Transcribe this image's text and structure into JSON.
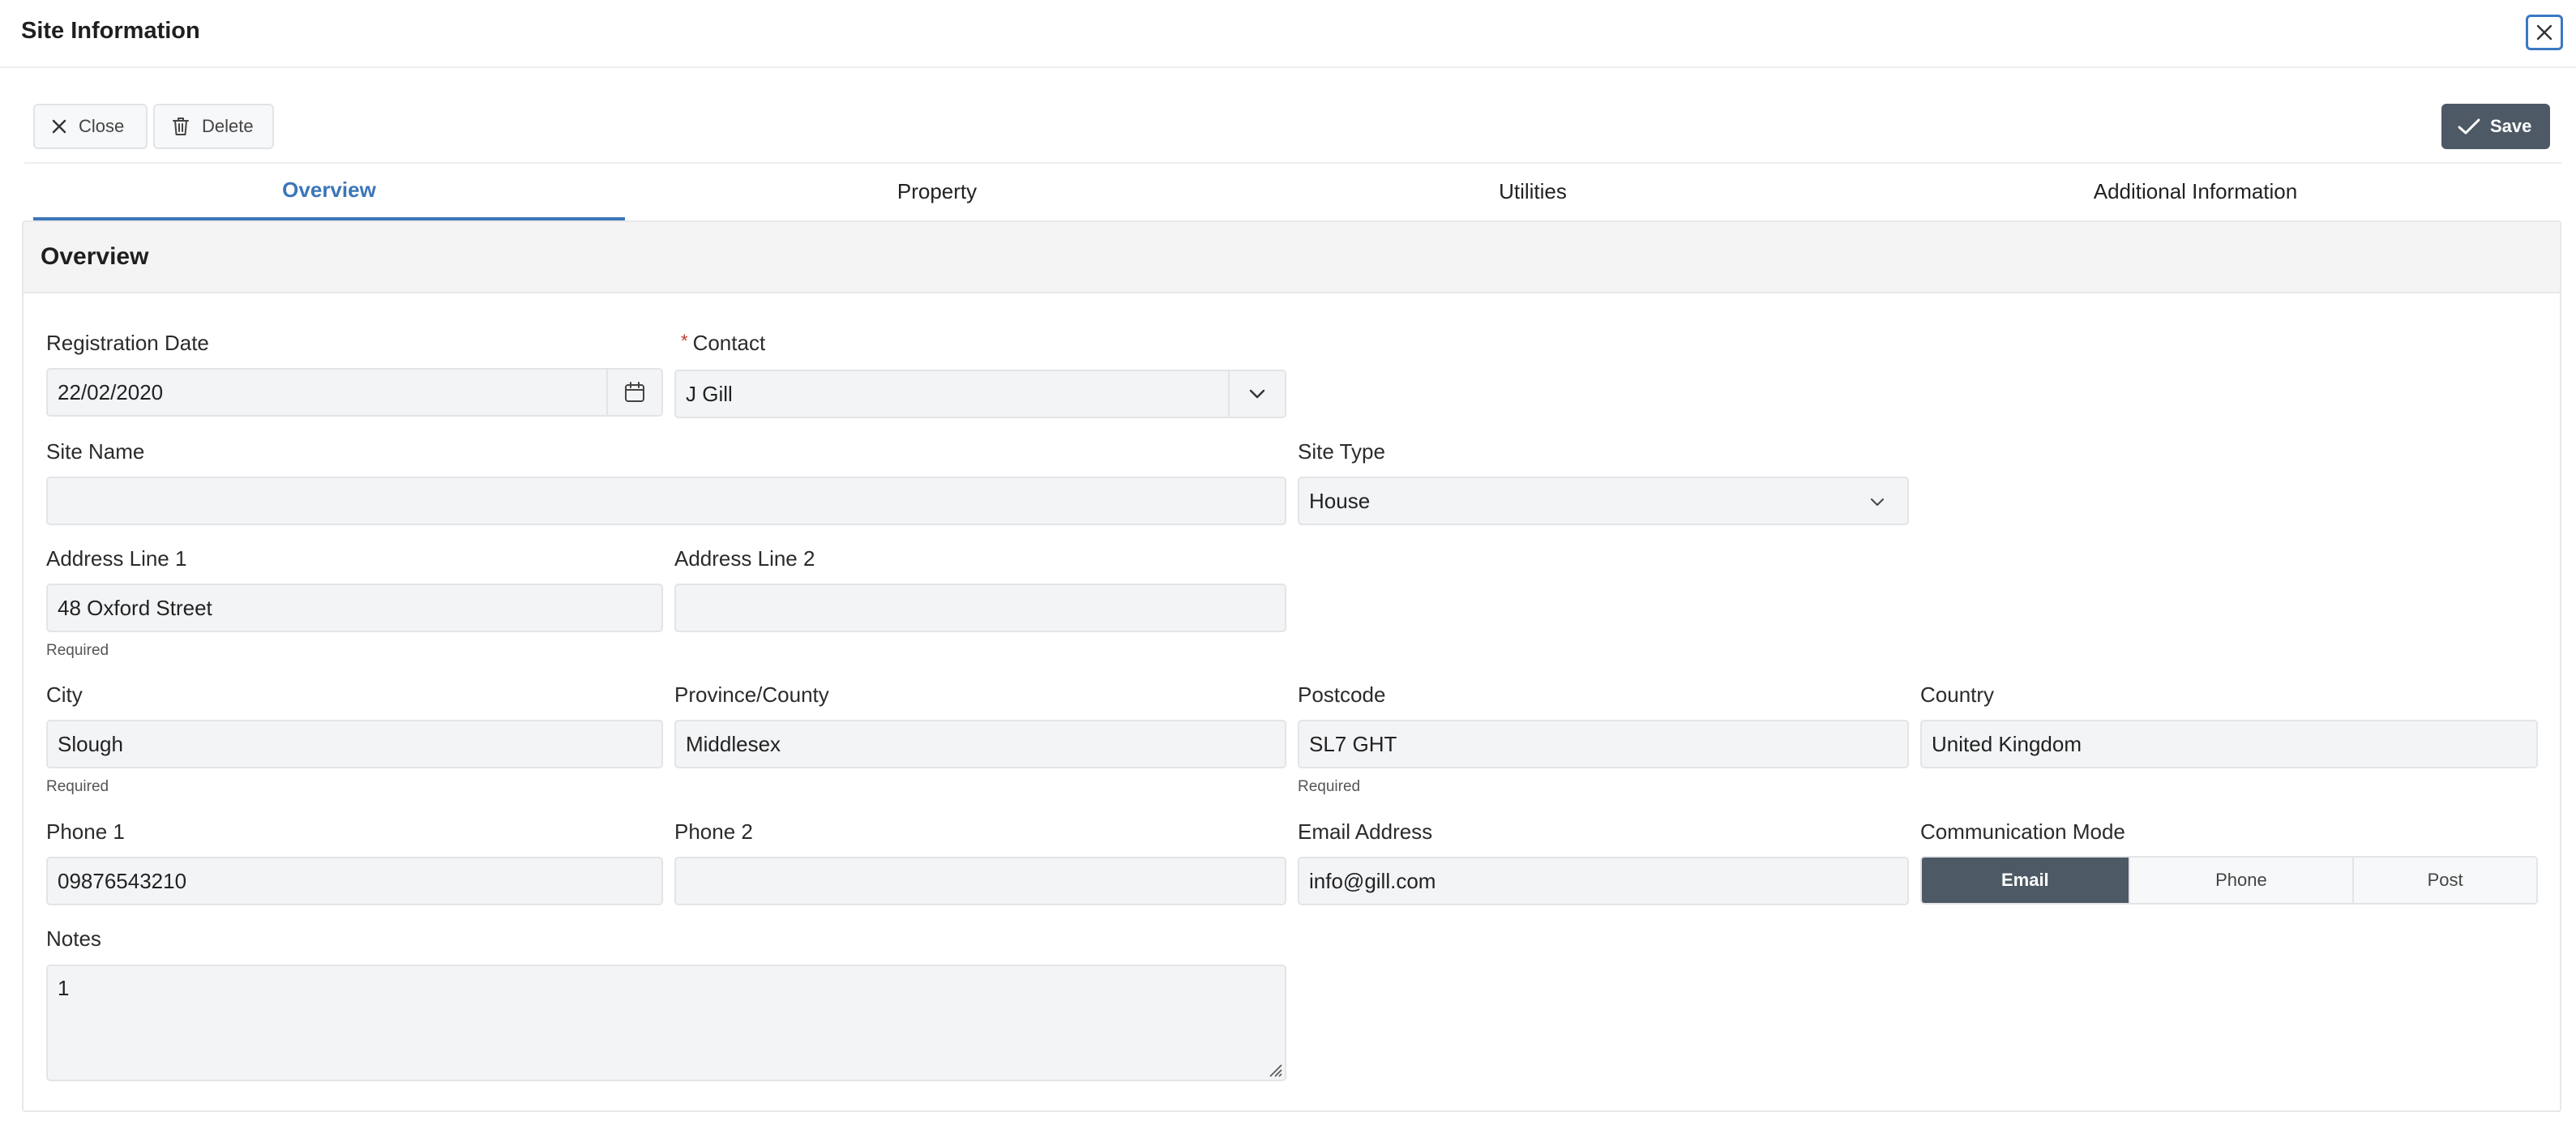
{
  "window": {
    "title": "Site Information"
  },
  "toolbar": {
    "close_label": "Close",
    "delete_label": "Delete",
    "save_label": "Save"
  },
  "tabs": [
    {
      "label": "Overview",
      "active": true
    },
    {
      "label": "Property",
      "active": false
    },
    {
      "label": "Utilities",
      "active": false
    },
    {
      "label": "Additional Information",
      "active": false
    }
  ],
  "section": {
    "title": "Overview"
  },
  "form": {
    "registration_date": {
      "label": "Registration Date",
      "value": "22/02/2020"
    },
    "contact": {
      "label": "Contact",
      "required_mark": "*",
      "value": "J Gill"
    },
    "site_name": {
      "label": "Site Name",
      "value": ""
    },
    "site_type": {
      "label": "Site Type",
      "value": "House"
    },
    "address_line_1": {
      "label": "Address Line 1",
      "value": "48 Oxford Street",
      "hint": "Required"
    },
    "address_line_2": {
      "label": "Address Line 2",
      "value": ""
    },
    "city": {
      "label": "City",
      "value": "Slough",
      "hint": "Required"
    },
    "province": {
      "label": "Province/County",
      "value": "Middlesex"
    },
    "postcode": {
      "label": "Postcode",
      "value": "SL7 GHT",
      "hint": "Required"
    },
    "country": {
      "label": "Country",
      "value": "United Kingdom"
    },
    "phone_1": {
      "label": "Phone 1",
      "value": "09876543210"
    },
    "phone_2": {
      "label": "Phone 2",
      "value": ""
    },
    "email": {
      "label": "Email Address",
      "value": "info@gill.com"
    },
    "communication_mode": {
      "label": "Communication Mode",
      "options": [
        "Email",
        "Phone",
        "Post"
      ],
      "selected": "Email"
    },
    "notes": {
      "label": "Notes",
      "value": "1"
    }
  },
  "colors": {
    "accent": "#3c76b8",
    "dark_button": "#4d5965",
    "required_star": "#c0392b"
  }
}
